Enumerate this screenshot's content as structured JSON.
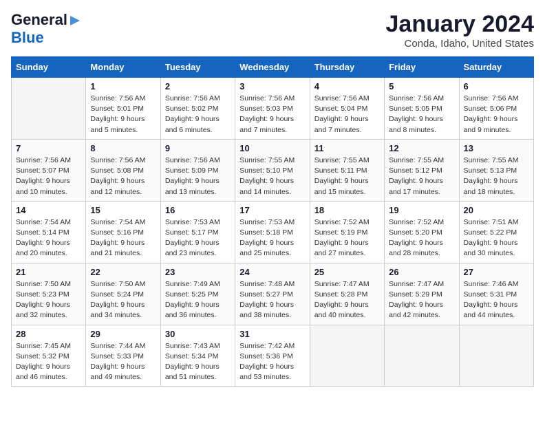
{
  "logo": {
    "line1": "General",
    "line2": "Blue"
  },
  "title": "January 2024",
  "location": "Conda, Idaho, United States",
  "weekdays": [
    "Sunday",
    "Monday",
    "Tuesday",
    "Wednesday",
    "Thursday",
    "Friday",
    "Saturday"
  ],
  "weeks": [
    [
      {
        "day": "",
        "sunrise": "",
        "sunset": "",
        "daylight": ""
      },
      {
        "day": "1",
        "sunrise": "Sunrise: 7:56 AM",
        "sunset": "Sunset: 5:01 PM",
        "daylight": "Daylight: 9 hours and 5 minutes."
      },
      {
        "day": "2",
        "sunrise": "Sunrise: 7:56 AM",
        "sunset": "Sunset: 5:02 PM",
        "daylight": "Daylight: 9 hours and 6 minutes."
      },
      {
        "day": "3",
        "sunrise": "Sunrise: 7:56 AM",
        "sunset": "Sunset: 5:03 PM",
        "daylight": "Daylight: 9 hours and 7 minutes."
      },
      {
        "day": "4",
        "sunrise": "Sunrise: 7:56 AM",
        "sunset": "Sunset: 5:04 PM",
        "daylight": "Daylight: 9 hours and 7 minutes."
      },
      {
        "day": "5",
        "sunrise": "Sunrise: 7:56 AM",
        "sunset": "Sunset: 5:05 PM",
        "daylight": "Daylight: 9 hours and 8 minutes."
      },
      {
        "day": "6",
        "sunrise": "Sunrise: 7:56 AM",
        "sunset": "Sunset: 5:06 PM",
        "daylight": "Daylight: 9 hours and 9 minutes."
      }
    ],
    [
      {
        "day": "7",
        "sunrise": "Sunrise: 7:56 AM",
        "sunset": "Sunset: 5:07 PM",
        "daylight": "Daylight: 9 hours and 10 minutes."
      },
      {
        "day": "8",
        "sunrise": "Sunrise: 7:56 AM",
        "sunset": "Sunset: 5:08 PM",
        "daylight": "Daylight: 9 hours and 12 minutes."
      },
      {
        "day": "9",
        "sunrise": "Sunrise: 7:56 AM",
        "sunset": "Sunset: 5:09 PM",
        "daylight": "Daylight: 9 hours and 13 minutes."
      },
      {
        "day": "10",
        "sunrise": "Sunrise: 7:55 AM",
        "sunset": "Sunset: 5:10 PM",
        "daylight": "Daylight: 9 hours and 14 minutes."
      },
      {
        "day": "11",
        "sunrise": "Sunrise: 7:55 AM",
        "sunset": "Sunset: 5:11 PM",
        "daylight": "Daylight: 9 hours and 15 minutes."
      },
      {
        "day": "12",
        "sunrise": "Sunrise: 7:55 AM",
        "sunset": "Sunset: 5:12 PM",
        "daylight": "Daylight: 9 hours and 17 minutes."
      },
      {
        "day": "13",
        "sunrise": "Sunrise: 7:55 AM",
        "sunset": "Sunset: 5:13 PM",
        "daylight": "Daylight: 9 hours and 18 minutes."
      }
    ],
    [
      {
        "day": "14",
        "sunrise": "Sunrise: 7:54 AM",
        "sunset": "Sunset: 5:14 PM",
        "daylight": "Daylight: 9 hours and 20 minutes."
      },
      {
        "day": "15",
        "sunrise": "Sunrise: 7:54 AM",
        "sunset": "Sunset: 5:16 PM",
        "daylight": "Daylight: 9 hours and 21 minutes."
      },
      {
        "day": "16",
        "sunrise": "Sunrise: 7:53 AM",
        "sunset": "Sunset: 5:17 PM",
        "daylight": "Daylight: 9 hours and 23 minutes."
      },
      {
        "day": "17",
        "sunrise": "Sunrise: 7:53 AM",
        "sunset": "Sunset: 5:18 PM",
        "daylight": "Daylight: 9 hours and 25 minutes."
      },
      {
        "day": "18",
        "sunrise": "Sunrise: 7:52 AM",
        "sunset": "Sunset: 5:19 PM",
        "daylight": "Daylight: 9 hours and 27 minutes."
      },
      {
        "day": "19",
        "sunrise": "Sunrise: 7:52 AM",
        "sunset": "Sunset: 5:20 PM",
        "daylight": "Daylight: 9 hours and 28 minutes."
      },
      {
        "day": "20",
        "sunrise": "Sunrise: 7:51 AM",
        "sunset": "Sunset: 5:22 PM",
        "daylight": "Daylight: 9 hours and 30 minutes."
      }
    ],
    [
      {
        "day": "21",
        "sunrise": "Sunrise: 7:50 AM",
        "sunset": "Sunset: 5:23 PM",
        "daylight": "Daylight: 9 hours and 32 minutes."
      },
      {
        "day": "22",
        "sunrise": "Sunrise: 7:50 AM",
        "sunset": "Sunset: 5:24 PM",
        "daylight": "Daylight: 9 hours and 34 minutes."
      },
      {
        "day": "23",
        "sunrise": "Sunrise: 7:49 AM",
        "sunset": "Sunset: 5:25 PM",
        "daylight": "Daylight: 9 hours and 36 minutes."
      },
      {
        "day": "24",
        "sunrise": "Sunrise: 7:48 AM",
        "sunset": "Sunset: 5:27 PM",
        "daylight": "Daylight: 9 hours and 38 minutes."
      },
      {
        "day": "25",
        "sunrise": "Sunrise: 7:47 AM",
        "sunset": "Sunset: 5:28 PM",
        "daylight": "Daylight: 9 hours and 40 minutes."
      },
      {
        "day": "26",
        "sunrise": "Sunrise: 7:47 AM",
        "sunset": "Sunset: 5:29 PM",
        "daylight": "Daylight: 9 hours and 42 minutes."
      },
      {
        "day": "27",
        "sunrise": "Sunrise: 7:46 AM",
        "sunset": "Sunset: 5:31 PM",
        "daylight": "Daylight: 9 hours and 44 minutes."
      }
    ],
    [
      {
        "day": "28",
        "sunrise": "Sunrise: 7:45 AM",
        "sunset": "Sunset: 5:32 PM",
        "daylight": "Daylight: 9 hours and 46 minutes."
      },
      {
        "day": "29",
        "sunrise": "Sunrise: 7:44 AM",
        "sunset": "Sunset: 5:33 PM",
        "daylight": "Daylight: 9 hours and 49 minutes."
      },
      {
        "day": "30",
        "sunrise": "Sunrise: 7:43 AM",
        "sunset": "Sunset: 5:34 PM",
        "daylight": "Daylight: 9 hours and 51 minutes."
      },
      {
        "day": "31",
        "sunrise": "Sunrise: 7:42 AM",
        "sunset": "Sunset: 5:36 PM",
        "daylight": "Daylight: 9 hours and 53 minutes."
      },
      {
        "day": "",
        "sunrise": "",
        "sunset": "",
        "daylight": ""
      },
      {
        "day": "",
        "sunrise": "",
        "sunset": "",
        "daylight": ""
      },
      {
        "day": "",
        "sunrise": "",
        "sunset": "",
        "daylight": ""
      }
    ]
  ]
}
